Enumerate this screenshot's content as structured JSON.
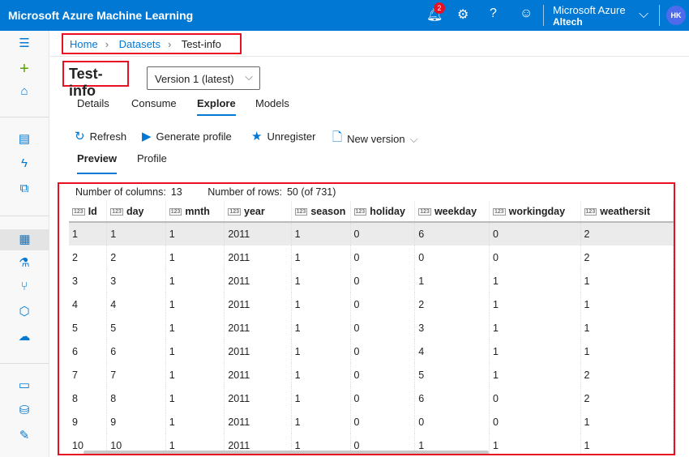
{
  "header": {
    "app_title": "Microsoft Azure Machine Learning",
    "notification_count": "2",
    "account_name": "Microsoft Azure",
    "tenant": "Altech",
    "avatar_initials": "HK"
  },
  "breadcrumb": [
    "Home",
    "Datasets",
    "Test-info"
  ],
  "page": {
    "title": "Test-info",
    "version": "Version 1 (latest)"
  },
  "tabs": [
    "Details",
    "Consume",
    "Explore",
    "Models"
  ],
  "active_tab": "Explore",
  "toolbar": {
    "refresh": "Refresh",
    "generate_profile": "Generate profile",
    "unregister": "Unregister",
    "new_version": "New version"
  },
  "subtabs": [
    "Preview",
    "Profile"
  ],
  "meta": {
    "columns_label": "Number of columns:",
    "columns": "13",
    "rows_label": "Number of rows:",
    "rows": "50 (of 731)"
  },
  "table": {
    "columns": [
      "Id",
      "day",
      "mnth",
      "year",
      "season",
      "holiday",
      "weekday",
      "workingday",
      "weathersit"
    ],
    "rows": [
      [
        "1",
        "1",
        "1",
        "2011",
        "1",
        "0",
        "6",
        "0",
        "2"
      ],
      [
        "2",
        "2",
        "1",
        "2011",
        "1",
        "0",
        "0",
        "0",
        "2"
      ],
      [
        "3",
        "3",
        "1",
        "2011",
        "1",
        "0",
        "1",
        "1",
        "1"
      ],
      [
        "4",
        "4",
        "1",
        "2011",
        "1",
        "0",
        "2",
        "1",
        "1"
      ],
      [
        "5",
        "5",
        "1",
        "2011",
        "1",
        "0",
        "3",
        "1",
        "1"
      ],
      [
        "6",
        "6",
        "1",
        "2011",
        "1",
        "0",
        "4",
        "1",
        "1"
      ],
      [
        "7",
        "7",
        "1",
        "2011",
        "1",
        "0",
        "5",
        "1",
        "2"
      ],
      [
        "8",
        "8",
        "1",
        "2011",
        "1",
        "0",
        "6",
        "0",
        "2"
      ],
      [
        "9",
        "9",
        "1",
        "2011",
        "1",
        "0",
        "0",
        "0",
        "1"
      ],
      [
        "10",
        "10",
        "1",
        "2011",
        "1",
        "0",
        "1",
        "1",
        "1"
      ]
    ]
  },
  "colors": {
    "brand": "#0078d4",
    "highlight": "#e81123"
  }
}
